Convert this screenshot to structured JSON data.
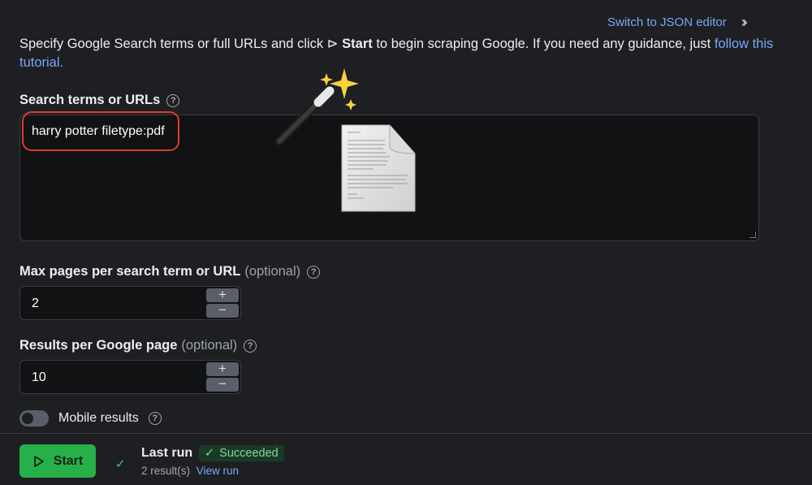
{
  "header": {
    "json_editor_link": "Switch to JSON editor",
    "collapse_icon": "double-chevron-right-icon"
  },
  "intro": {
    "text_before": "Specify Google Search terms or full URLs and click ",
    "start_symbol": "⊳",
    "start_word": "Start",
    "text_after": " to begin scraping Google. If you need any guidance, just ",
    "link_text": "follow this tutorial."
  },
  "search_terms": {
    "label": "Search terms or URLs",
    "value": "harry potter filetype:pdf",
    "highlight_color": "#e23a2c"
  },
  "max_pages": {
    "label": "Max pages per search term or URL",
    "optional": "(optional)",
    "value": "2"
  },
  "results_per_page": {
    "label": "Results per Google page",
    "optional": "(optional)",
    "value": "10"
  },
  "mobile_results": {
    "label": "Mobile results",
    "enabled": false
  },
  "footer": {
    "start_label": "Start",
    "last_run_label": "Last run",
    "status_label": "Succeeded",
    "results_count": "2 result(s)",
    "view_run_link": "View run",
    "accent_color": "#27b04a"
  },
  "stepper": {
    "plus": "+",
    "minus": "−"
  },
  "help_glyph": "?"
}
